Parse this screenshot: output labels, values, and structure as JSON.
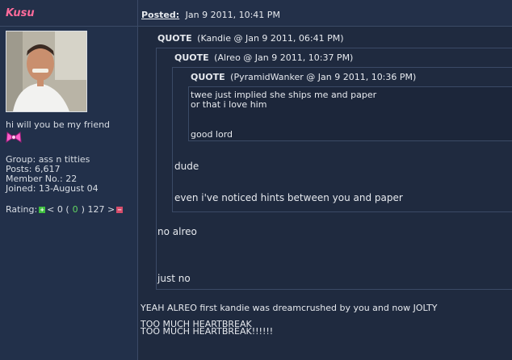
{
  "post": {
    "author": "Kusu",
    "posted_label": "Posted:",
    "posted_date": "Jan 9 2011, 10:41 PM"
  },
  "profile": {
    "signature": "hi will you be my friend",
    "group": "Group: ass n titties",
    "posts": "Posts: 6,617",
    "member_no": "Member No.: 22",
    "joined": "Joined: 13-August 04",
    "rating_label": "Rating:",
    "rating_left": "< 0 (",
    "rating_count": "0",
    "rating_right": ") 127 >",
    "colors": {
      "name": "#ff6b9b",
      "plus": "#3fbf3f",
      "minus": "#d64c6a"
    }
  },
  "quotes": {
    "label": "QUOTE",
    "q1_meta": "(Kandie @ Jan 9 2011, 06:41 PM)",
    "q2_meta": "(Alreo @ Jan 9 2011, 10:37 PM)",
    "q3_meta": "(PyramidWanker @ Jan 9 2011, 10:36 PM)",
    "q3_line1": "twee just implied she ships me and paper",
    "q3_line2": "or that i love him",
    "q3_line3": "good lord",
    "q2_line1": "dude",
    "q2_line2": "even i've noticed hints between you and paper",
    "q1_line1": "no alreo",
    "q1_line2": "just no"
  },
  "body": {
    "line1": "YEAH ALREO first kandie was dreamcrushed by you and now JOLTY",
    "line2": "TOO MUCH HEARTBREAK",
    "line3": "TOO MUCH HEARTBREAK!!!!!!"
  }
}
